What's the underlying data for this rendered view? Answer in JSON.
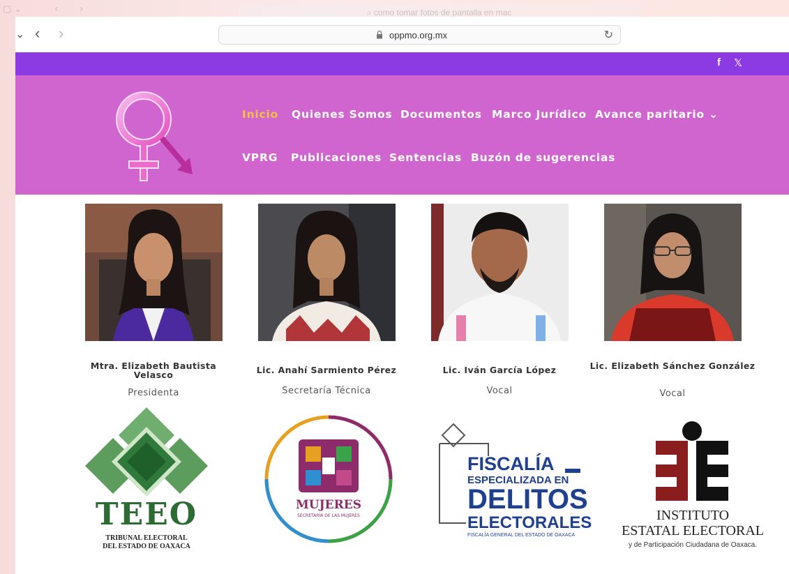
{
  "browser": {
    "ghost_url": "como tomar fotos de pantalla en mac",
    "url": "oppmo.org.mx"
  },
  "social": {
    "facebook": "f",
    "x": "𝕏"
  },
  "menu": {
    "items": [
      "Inicio",
      "Quienes Somos",
      "Documentos",
      "Marco Jurídico",
      "Avance paritario ⌄",
      "VPRG",
      "Publicaciones",
      "Sentencias",
      "Buzón de sugerencias"
    ],
    "active": "Inicio"
  },
  "members": [
    {
      "name": "Mtra. Elizabeth Bautista Velasco",
      "role": "Presidenta"
    },
    {
      "name": "Lic. Anahí Sarmiento Pérez",
      "role": "Secretaría Técnica"
    },
    {
      "name": "Lic. Iván García López",
      "role": "Vocal"
    },
    {
      "name": "Lic. Elizabeth Sánchez González",
      "role": "Vocal"
    }
  ],
  "partners": {
    "teeo": {
      "acronym": "TEEO",
      "line1": "TRIBUNAL ELECTORAL",
      "line2": "DEL ESTADO DE OAXACA"
    },
    "mujeres": {
      "title": "MUJERES",
      "subtitle": "SECRETARÍA DE LAS MUJERES"
    },
    "fiscalia": {
      "l1": "FISCALÍA",
      "l2": "ESPECIALIZADA EN",
      "l3": "DELITOS",
      "l4": "ELECTORALES",
      "l5": "FISCALÍA GENERAL DEL ESTADO DE OAXACA"
    },
    "ieepco": {
      "l1": "INSTITUTO",
      "l2": "ESTATAL ELECTORAL",
      "l3": "y de Participación Ciudadana de Oaxaca."
    }
  },
  "colors": {
    "topbar": "#8c3be3",
    "header": "#d065d0",
    "active_menu": "#f5c33b"
  }
}
